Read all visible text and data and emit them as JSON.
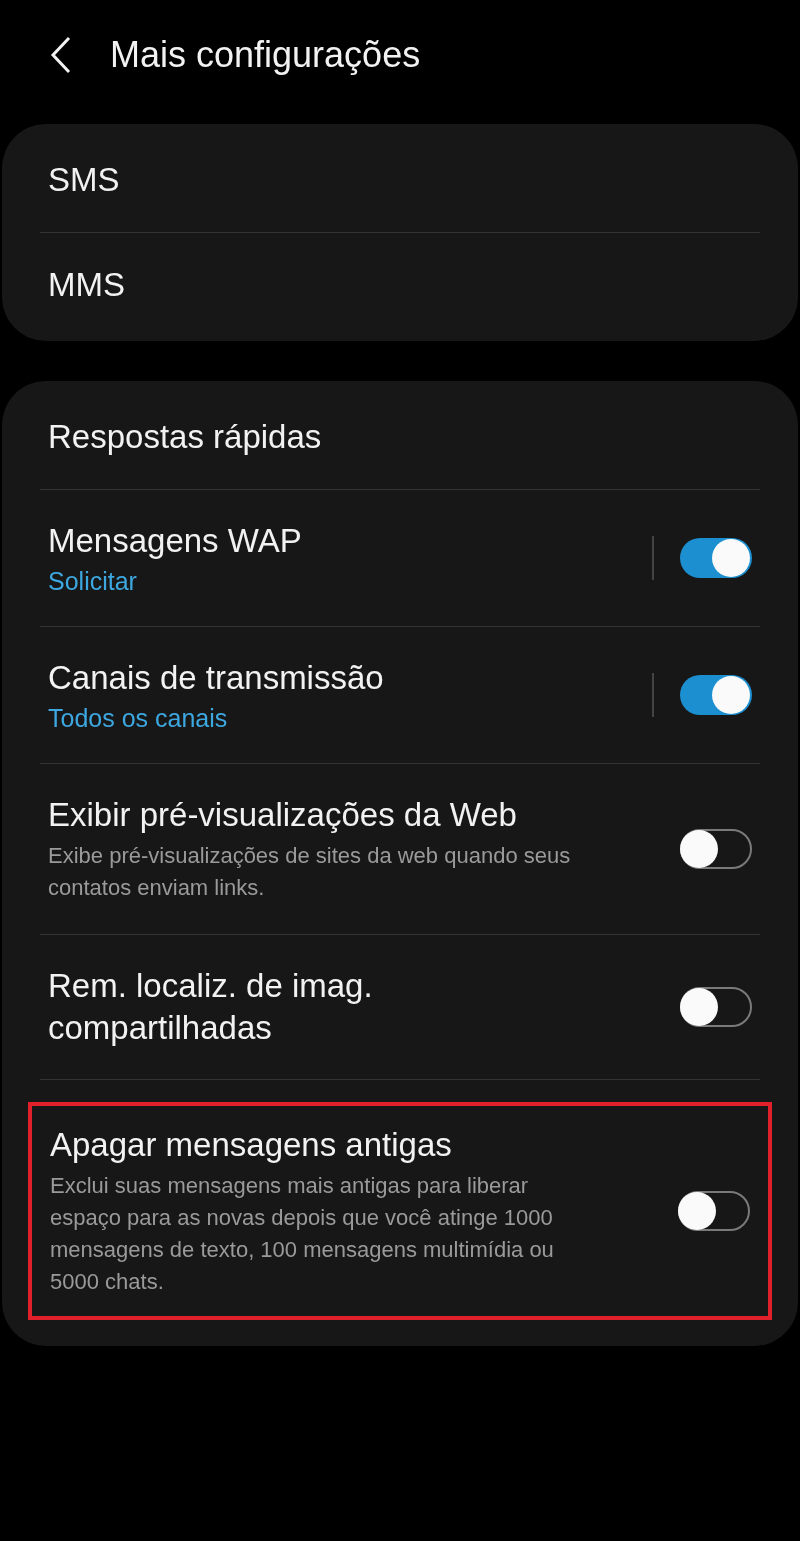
{
  "header": {
    "title": "Mais configurações"
  },
  "groups": [
    {
      "items": [
        {
          "kind": "link",
          "title": "SMS",
          "highlighted": false
        },
        {
          "kind": "link",
          "title": "MMS",
          "highlighted": false
        }
      ]
    },
    {
      "items": [
        {
          "kind": "link",
          "title": "Respostas rápidas",
          "highlighted": false
        },
        {
          "kind": "switch_link",
          "title": "Mensagens WAP",
          "subtitle": "Solicitar",
          "on": true,
          "highlighted": false
        },
        {
          "kind": "switch_link",
          "title": "Canais de transmissão",
          "subtitle": "Todos os canais",
          "on": true,
          "highlighted": false
        },
        {
          "kind": "toggle",
          "title": "Exibir pré-visualizações da Web",
          "subtitle": "Exibe pré-visualizações de sites da web quando seus contatos enviam links.",
          "on": false,
          "highlighted": false
        },
        {
          "kind": "toggle",
          "title": "Rem. localiz. de imag. compartilhadas",
          "on": false,
          "highlighted": false
        },
        {
          "kind": "toggle",
          "title": "Apagar mensagens antigas",
          "subtitle": "Exclui suas mensagens mais antigas para liberar espaço para as novas depois que você atinge 1000 mensagens de texto, 100 mensagens multimídia ou 5000 chats.",
          "on": false,
          "highlighted": true
        }
      ]
    }
  ]
}
